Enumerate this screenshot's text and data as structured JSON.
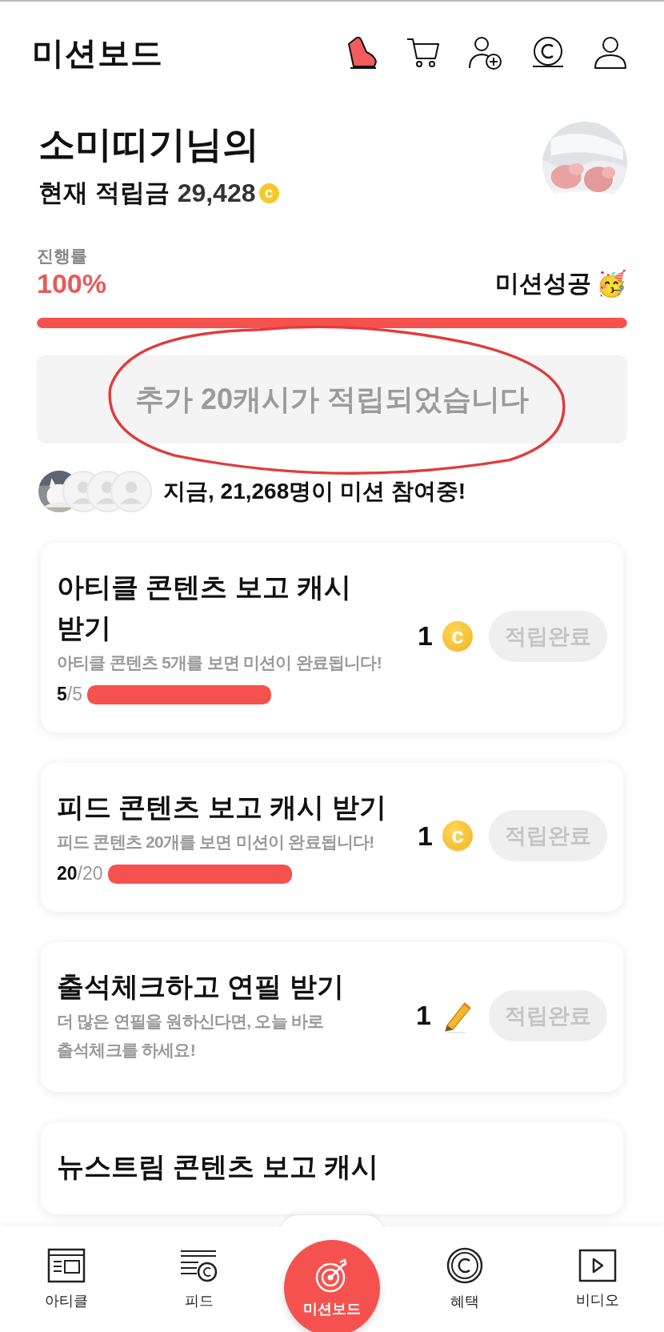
{
  "header": {
    "title": "미션보드"
  },
  "profile": {
    "name": "소미띠기님의",
    "balance_label": "현재 적립금",
    "balance": "29,428",
    "coin_symbol": "c"
  },
  "progress": {
    "label": "진행률",
    "percent": "100%",
    "status": "미션성공",
    "status_emoji": "🥳",
    "level": 1
  },
  "notice": {
    "text": "추가 20캐시가 적립되었습니다"
  },
  "participants": {
    "text": "지금, **21,268명**이 미션 참여중!"
  },
  "missions": [
    {
      "title": "아티클 콘텐츠 보고 캐시 받기",
      "description": "아티클 콘텐츠 5개를 보면 미션이 완료됩니다!",
      "progress_done": "5",
      "progress_total": "/5",
      "level": 1,
      "reward": "1",
      "kind": "coin",
      "coin_symbol": "c",
      "button": "적립완료",
      "completed": true
    },
    {
      "title": "피드 콘텐츠 보고 캐시 받기",
      "description": "피드 콘텐츠 20개를 보면 미션이 완료됩니다!",
      "progress_done": "20",
      "progress_total": "/20",
      "level": 1,
      "reward": "1",
      "kind": "coin",
      "coin_symbol": "c",
      "button": "적립완료",
      "completed": true
    },
    {
      "title": "출석체크하고 연필 받기",
      "description": "더 많은 연필을 원하신다면, 오늘 바로 출석체크를 하세요!",
      "reward": "1",
      "kind": "pencil",
      "button": "적립완료",
      "completed": true
    },
    {
      "title": "뉴스트림 콘텐츠 보고 캐시"
    }
  ],
  "nav": [
    {
      "label": "아티클",
      "kind": "article",
      "selected": false
    },
    {
      "label": "피드",
      "kind": "feed",
      "selected": false
    },
    {
      "label": "미션보드",
      "kind": "target",
      "selected": true
    },
    {
      "label": "혜택",
      "kind": "benefit",
      "selected": false
    },
    {
      "label": "비디오",
      "kind": "video",
      "selected": false
    }
  ]
}
